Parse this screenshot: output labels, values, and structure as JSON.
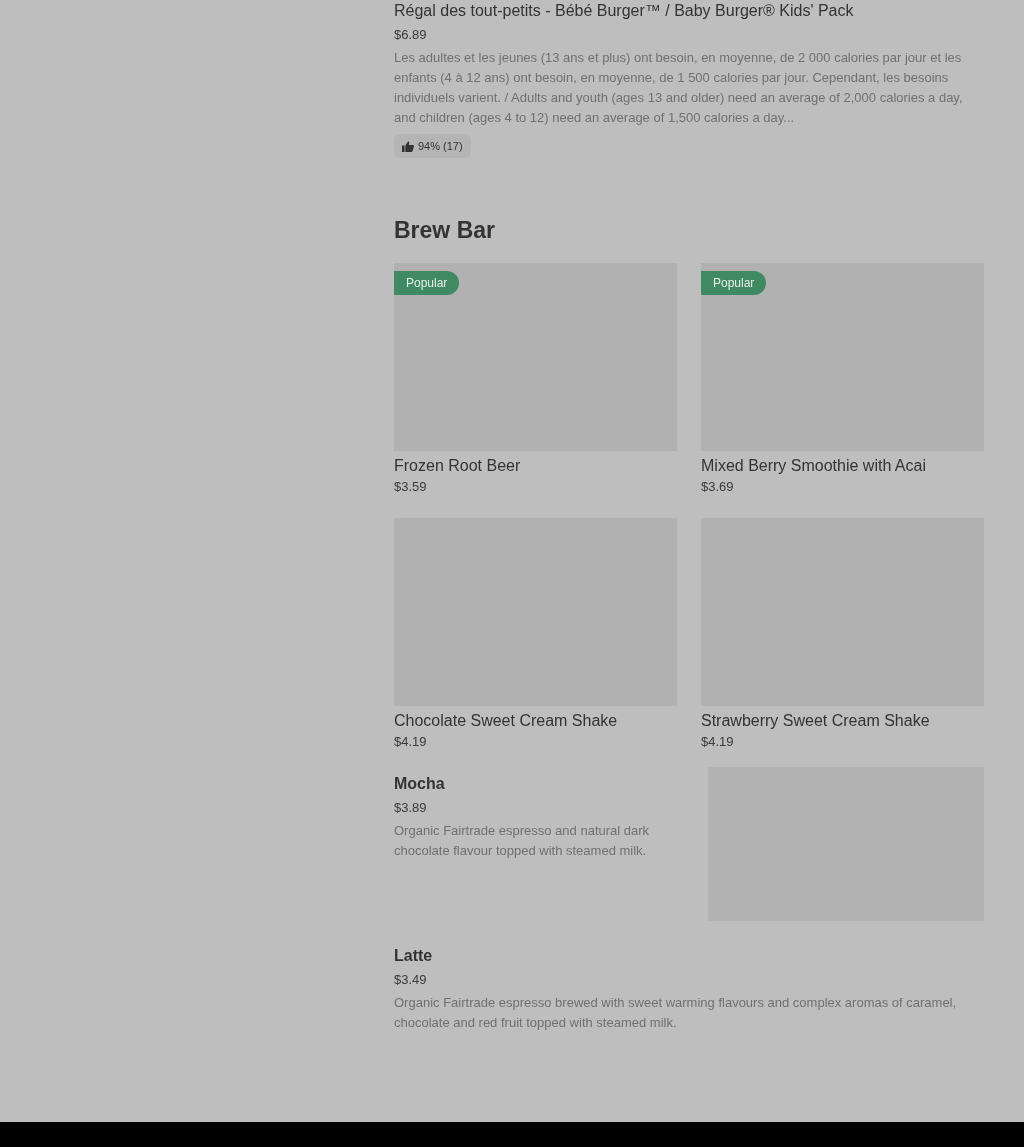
{
  "top_item": {
    "name": "Régal des tout-petits - Bébé Burger™ / Baby Burger® Kids' Pack",
    "price": "$6.89",
    "description": "Les adultes et les jeunes (13 ans et plus) ont besoin, en moyenne, de 2 000 calories par jour et les enfants (4 à 12 ans) ont besoin, en moyenne, de 1 500 calories par jour. Cependant, les besoins individuels varient. / Adults and youth (ages 13 and older) need an average of 2,000 calories a day, and children (ages 4 to 12) need an average of 1,500 calories a day...",
    "rating": "94% (17)"
  },
  "section": {
    "title": "Brew Bar",
    "items": [
      {
        "kind": "card",
        "name": "Frozen Root Beer",
        "price": "$3.59",
        "badge": "Popular"
      },
      {
        "kind": "card",
        "name": "Mixed Berry Smoothie with Acai",
        "price": "$3.69",
        "badge": "Popular"
      },
      {
        "kind": "card",
        "name": "Chocolate Sweet Cream Shake",
        "price": "$4.19"
      },
      {
        "kind": "card",
        "name": "Strawberry Sweet Cream Shake",
        "price": "$4.19"
      },
      {
        "kind": "row_image",
        "name": "Mocha",
        "price": "$3.89",
        "description": "Organic Fairtrade espresso and natural dark chocolate flavour topped with steamed milk."
      },
      {
        "kind": "row",
        "name": "Latte",
        "price": "$3.49",
        "description": "Organic Fairtrade espresso brewed with sweet warming flavours and complex aromas of caramel, chocolate and red fruit topped with steamed milk."
      }
    ]
  }
}
